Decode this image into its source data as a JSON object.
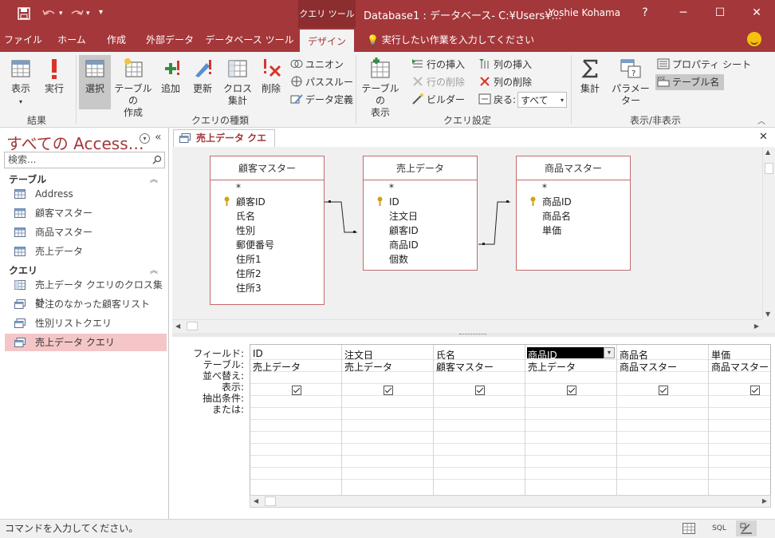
{
  "titlebar": {
    "context_tools": "クエリ ツール",
    "title": "Database1 : データベース- C:¥Users¥…",
    "user": "Yoshie Kohama",
    "help": "?"
  },
  "tabs": [
    {
      "label": "ファイル"
    },
    {
      "label": "ホーム"
    },
    {
      "label": "作成"
    },
    {
      "label": "外部データ"
    },
    {
      "label": "データベース ツール"
    },
    {
      "label": "デザイン"
    }
  ],
  "tell_me": "実行したい作業を入力してください",
  "ribbon": {
    "view": "表示",
    "run": "実行",
    "select": "選択",
    "make_table_1": "テーブルの",
    "make_table_2": "作成",
    "append": "追加",
    "update": "更新",
    "crosstab_1": "クロス",
    "crosstab_2": "集計",
    "delete": "削除",
    "union": "ユニオン",
    "passthrough": "パススルー",
    "data_def": "データ定義",
    "show_table_1": "テーブルの",
    "show_table_2": "表示",
    "insert_rows": "行の挿入",
    "delete_rows": "行の削除",
    "builder": "ビルダー",
    "insert_cols": "列の挿入",
    "delete_cols": "列の削除",
    "return_label": "戻る:",
    "return_value": "すべて",
    "totals": "集計",
    "parameters": "パラメーター",
    "property_sheet": "プロパティ シート",
    "table_names": "テーブル名",
    "group_results": "結果",
    "group_query_type": "クエリの種類",
    "group_query_setup": "クエリ設定",
    "group_show_hide": "表示/非表示"
  },
  "nav": {
    "title": "すべての Access…",
    "search_placeholder": "検索...",
    "section_tables": "テーブル",
    "tables": [
      "Address",
      "顧客マスター",
      "商品マスター",
      "売上データ"
    ],
    "section_queries": "クエリ",
    "queries": [
      "売上データ クエリのクロス集計",
      "受注のなかった顧客リスト",
      "性別リストクエリ",
      "売上データ クエリ"
    ]
  },
  "doc_tab": "売上データ クエリ",
  "tables": [
    {
      "name": "顧客マスター",
      "fields": [
        "*",
        "顧客ID",
        "氏名",
        "性別",
        "郵便番号",
        "住所1",
        "住所2",
        "住所3"
      ]
    },
    {
      "name": "売上データ",
      "fields": [
        "*",
        "ID",
        "注文日",
        "顧客ID",
        "商品ID",
        "個数"
      ]
    },
    {
      "name": "商品マスター",
      "fields": [
        "*",
        "商品ID",
        "商品名",
        "単価"
      ]
    }
  ],
  "grid": {
    "row_labels": [
      "フィールド:",
      "テーブル:",
      "並べ替え:",
      "表示:",
      "抽出条件:",
      "または:"
    ],
    "columns": [
      {
        "field": "ID",
        "table": "売上データ"
      },
      {
        "field": "注文日",
        "table": "売上データ"
      },
      {
        "field": "氏名",
        "table": "顧客マスター"
      },
      {
        "field": "商品ID",
        "table": "売上データ"
      },
      {
        "field": "商品名",
        "table": "商品マスター"
      },
      {
        "field": "単価",
        "table": "商品マスター"
      }
    ]
  },
  "status": {
    "text": "コマンドを入力してください。",
    "sql": "SQL"
  },
  "colors": {
    "accent": "#a4373a",
    "selected_nav": "#f4c6c7",
    "ribbon_bg": "#f3f3f3"
  }
}
